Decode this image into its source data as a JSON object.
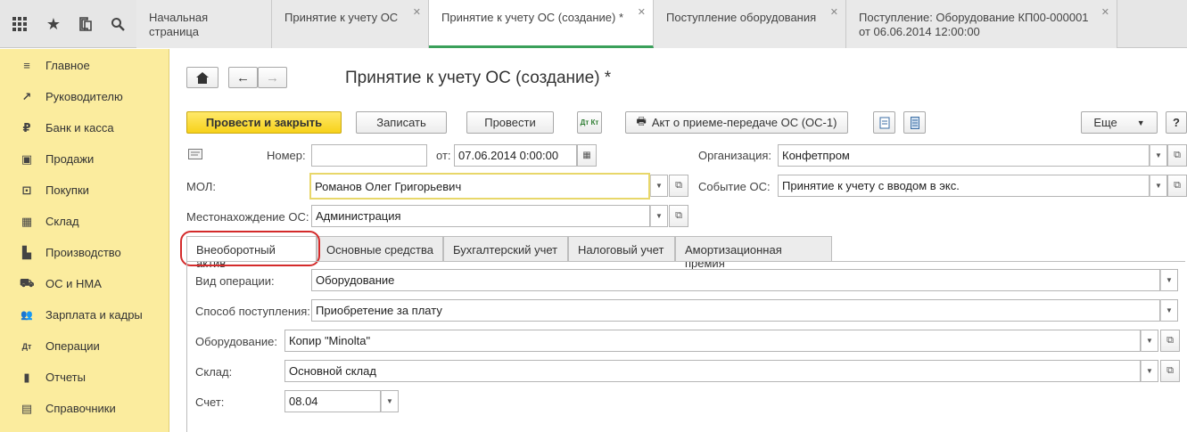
{
  "topbar": {
    "icons": [
      "grid-icon",
      "star-icon",
      "history-icon",
      "search-icon"
    ],
    "tabs": [
      {
        "label": "Начальная страница",
        "closable": false
      },
      {
        "label": "Принятие к учету ОС",
        "closable": true
      },
      {
        "label": "Принятие к учету ОС (создание) *",
        "closable": true,
        "active": true
      },
      {
        "label": "Поступление оборудования",
        "closable": true
      },
      {
        "label_line1": "Поступление: Оборудование КП00-000001",
        "label_line2": "от 06.06.2014 12:00:00",
        "closable": true
      }
    ]
  },
  "sidebar": {
    "items": [
      {
        "label": "Главное",
        "icon": "≡"
      },
      {
        "label": "Руководителю",
        "icon": "↗"
      },
      {
        "label": "Банк и касса",
        "icon": "₽"
      },
      {
        "label": "Продажи",
        "icon": "▣"
      },
      {
        "label": "Покупки",
        "icon": "⊡"
      },
      {
        "label": "Склад",
        "icon": "▦"
      },
      {
        "label": "Производство",
        "icon": "▙"
      },
      {
        "label": "ОС и НМА",
        "icon": "⛟"
      },
      {
        "label": "Зарплата и кадры",
        "icon": "👥"
      },
      {
        "label": "Операции",
        "icon": "Дт"
      },
      {
        "label": "Отчеты",
        "icon": "▮"
      },
      {
        "label": "Справочники",
        "icon": "▤"
      }
    ]
  },
  "doc": {
    "title": "Принятие к учету ОС (создание) *",
    "toolbar": {
      "post_close": "Провести и закрыть",
      "save": "Записать",
      "post": "Провести",
      "dtkt": "Дт Кт",
      "act": "Акт о приеме-передаче ОС (ОС-1)",
      "more": "Еще",
      "help": "?"
    },
    "fields": {
      "number_label": "Номер:",
      "number_value": "",
      "date_label": "от:",
      "date_value": "07.06.2014  0:00:00",
      "org_label": "Организация:",
      "org_value": "Конфетпром",
      "mol_label": "МОЛ:",
      "mol_value": "Романов Олег Григорьевич",
      "event_label": "Событие ОС:",
      "event_value": "Принятие к учету с вводом в экс.",
      "location_label": "Местонахождение ОС:",
      "location_value": "Администрация"
    },
    "tabs": [
      "Внеоборотный актив",
      "Основные средства",
      "Бухгалтерский учет",
      "Налоговый учет",
      "Амортизационная премия"
    ],
    "panel": {
      "op_type_label": "Вид операции:",
      "op_type_value": "Оборудование",
      "receipt_label": "Способ поступления:",
      "receipt_value": "Приобретение за плату",
      "equip_label": "Оборудование:",
      "equip_value": "Копир \"Minolta\"",
      "warehouse_label": "Склад:",
      "warehouse_value": "Основной склад",
      "account_label": "Счет:",
      "account_value": "08.04"
    }
  }
}
